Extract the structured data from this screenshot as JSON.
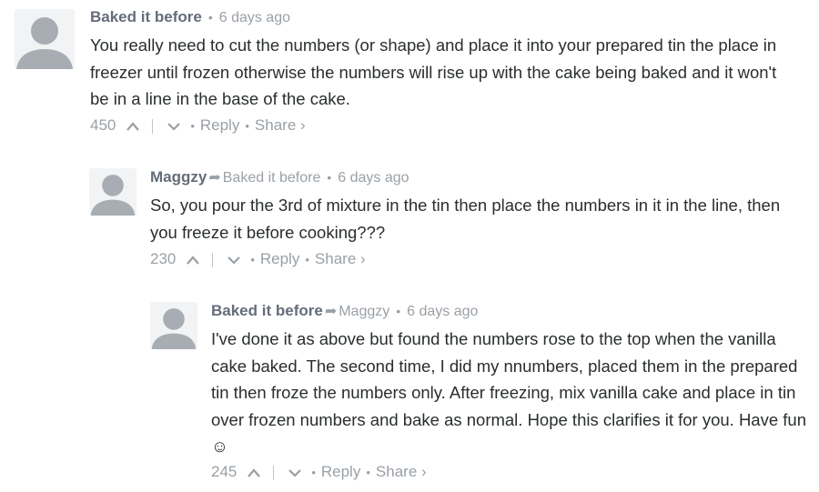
{
  "comments": [
    {
      "author": "Baked it before",
      "reply_to": "",
      "time": "6 days ago",
      "text": "You really need to cut the numbers (or shape) and place it into your prepared tin the place in freezer until frozen otherwise the numbers will rise up with the cake being baked and it won't be in a line in the base of the cake.",
      "votes": "450",
      "reply_label": "Reply",
      "share_label": "Share ›"
    },
    {
      "author": "Maggzy",
      "reply_to": "Baked it before",
      "time": "6 days ago",
      "text": "So, you pour the 3rd of mixture in the tin then place the numbers in it in the line, then you freeze it before cooking???",
      "votes": "230",
      "reply_label": "Reply",
      "share_label": "Share ›"
    },
    {
      "author": "Baked it before",
      "reply_to": "Maggzy",
      "time": "6 days ago",
      "text": "I've done it as above but found the numbers rose to the top when the vanilla cake baked. The second time, I did my nnumbers, placed them in the prepared tin then froze the numbers only. After freezing, mix vanilla cake and place in tin over frozen numbers and bake as normal. Hope this clarifies it for you. Have fun ☺",
      "votes": "245",
      "reply_label": "Reply",
      "share_label": "Share ›"
    }
  ],
  "icons": {
    "avatar": "default-avatar-icon",
    "upvote": "chevron-up-icon",
    "downvote": "chevron-down-icon",
    "reply_arrow": "reply-arrow-icon"
  },
  "colors": {
    "author": "#656c7a",
    "meta": "#9aa0a6",
    "text": "#2a2e2e",
    "avatar_bg": "#f0f2f3",
    "avatar_fg": "#a8adb3"
  }
}
